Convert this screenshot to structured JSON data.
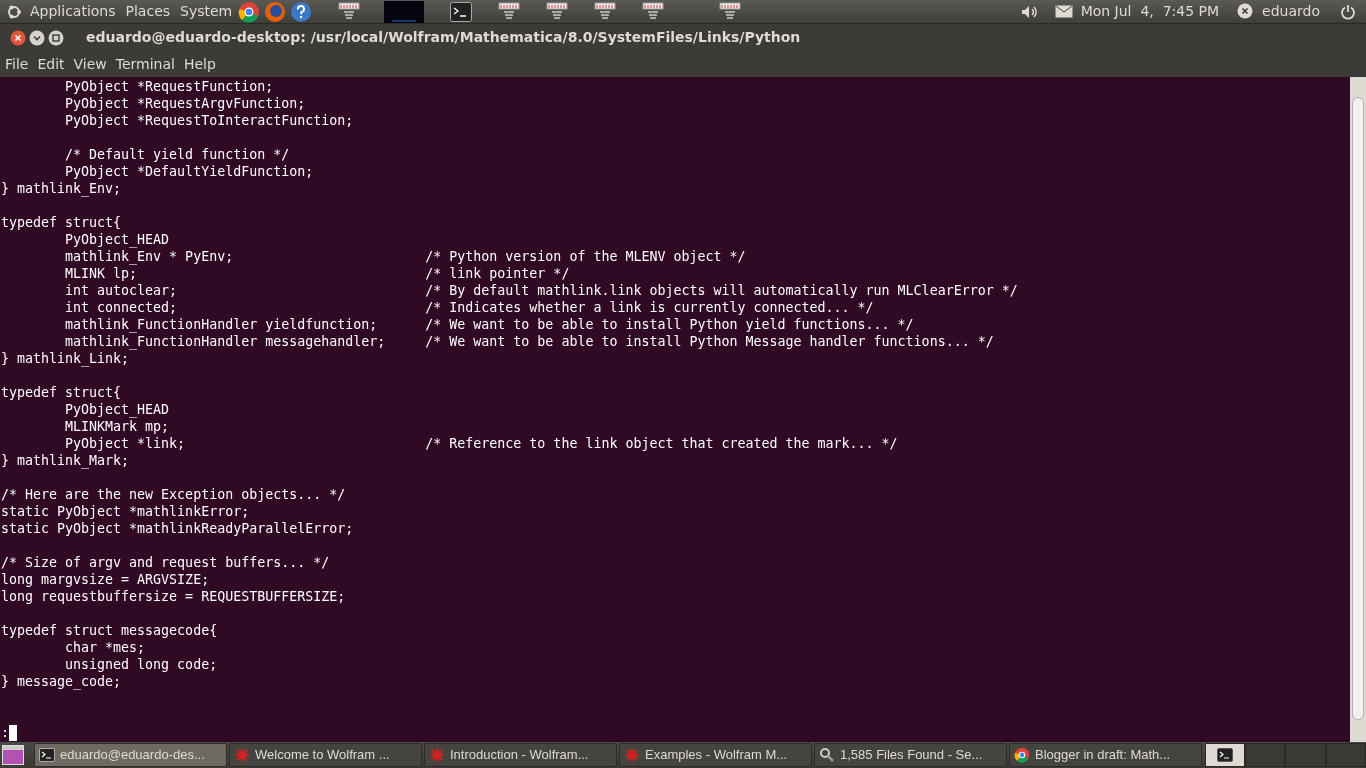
{
  "top_panel": {
    "menus": [
      "Applications",
      "Places",
      "System"
    ],
    "clock": "Mon Jul  4,  7:45 PM",
    "user": "eduardo"
  },
  "window": {
    "title": "eduardo@eduardo-desktop: /usr/local/Wolfram/Mathematica/8.0/SystemFiles/Links/Python",
    "menu": [
      "File",
      "Edit",
      "View",
      "Terminal",
      "Help"
    ]
  },
  "terminal": {
    "blocks": [
      [
        "        PyObject *RequestFunction;",
        "        PyObject *RequestArgvFunction;",
        "        PyObject *RequestToInteractFunction;"
      ],
      [
        "        /* Default yield function */",
        "        PyObject *DefaultYieldFunction;",
        "} mathlink_Env;"
      ],
      [
        "typedef struct{",
        "        PyObject_HEAD",
        "        mathlink_Env * PyEnv;                        /* Python version of the MLENV object */",
        "        MLINK lp;                                    /* link pointer */",
        "        int autoclear;                               /* By default mathlink.link objects will automatically run MLClearError */",
        "        int connected;                               /* Indicates whether a link is currently connected... */",
        "        mathlink_FunctionHandler yieldfunction;      /* We want to be able to install Python yield functions... */",
        "        mathlink_FunctionHandler messagehandler;     /* We want to be able to install Python Message handler functions... */",
        "} mathlink_Link;"
      ],
      [
        "typedef struct{",
        "        PyObject_HEAD",
        "        MLINKMark mp;",
        "        PyObject *link;                              /* Reference to the link object that created the mark... */",
        "} mathlink_Mark;"
      ],
      [
        "/* Here are the new Exception objects... */",
        "static PyObject *mathlinkError;",
        "static PyObject *mathlinkReadyParallelError;"
      ],
      [
        "/* Size of argv and request buffers... */",
        "long margvsize = ARGVSIZE;",
        "long requestbuffersize = REQUESTBUFFERSIZE;"
      ],
      [
        "typedef struct messagecode{",
        "        char *mes;",
        "        unsigned long code;",
        "} message_code;"
      ]
    ],
    "prompt": ":"
  },
  "taskbar": {
    "tasks": [
      {
        "label": "eduardo@eduardo-des...",
        "kind": "terminal",
        "selected": true
      },
      {
        "label": "Welcome to Wolfram ...",
        "kind": "mathematica",
        "selected": false
      },
      {
        "label": "Introduction - Wolfram...",
        "kind": "mathematica",
        "selected": false
      },
      {
        "label": "Examples - Wolfram M...",
        "kind": "mathematica",
        "selected": false
      },
      {
        "label": "1,585 Files Found - Se...",
        "kind": "search",
        "selected": false
      },
      {
        "label": "Blogger in draft: Math...",
        "kind": "browser",
        "selected": false
      }
    ],
    "workspaces": [
      {
        "selected": true
      },
      {
        "selected": false
      },
      {
        "selected": false
      },
      {
        "selected": false
      }
    ]
  }
}
